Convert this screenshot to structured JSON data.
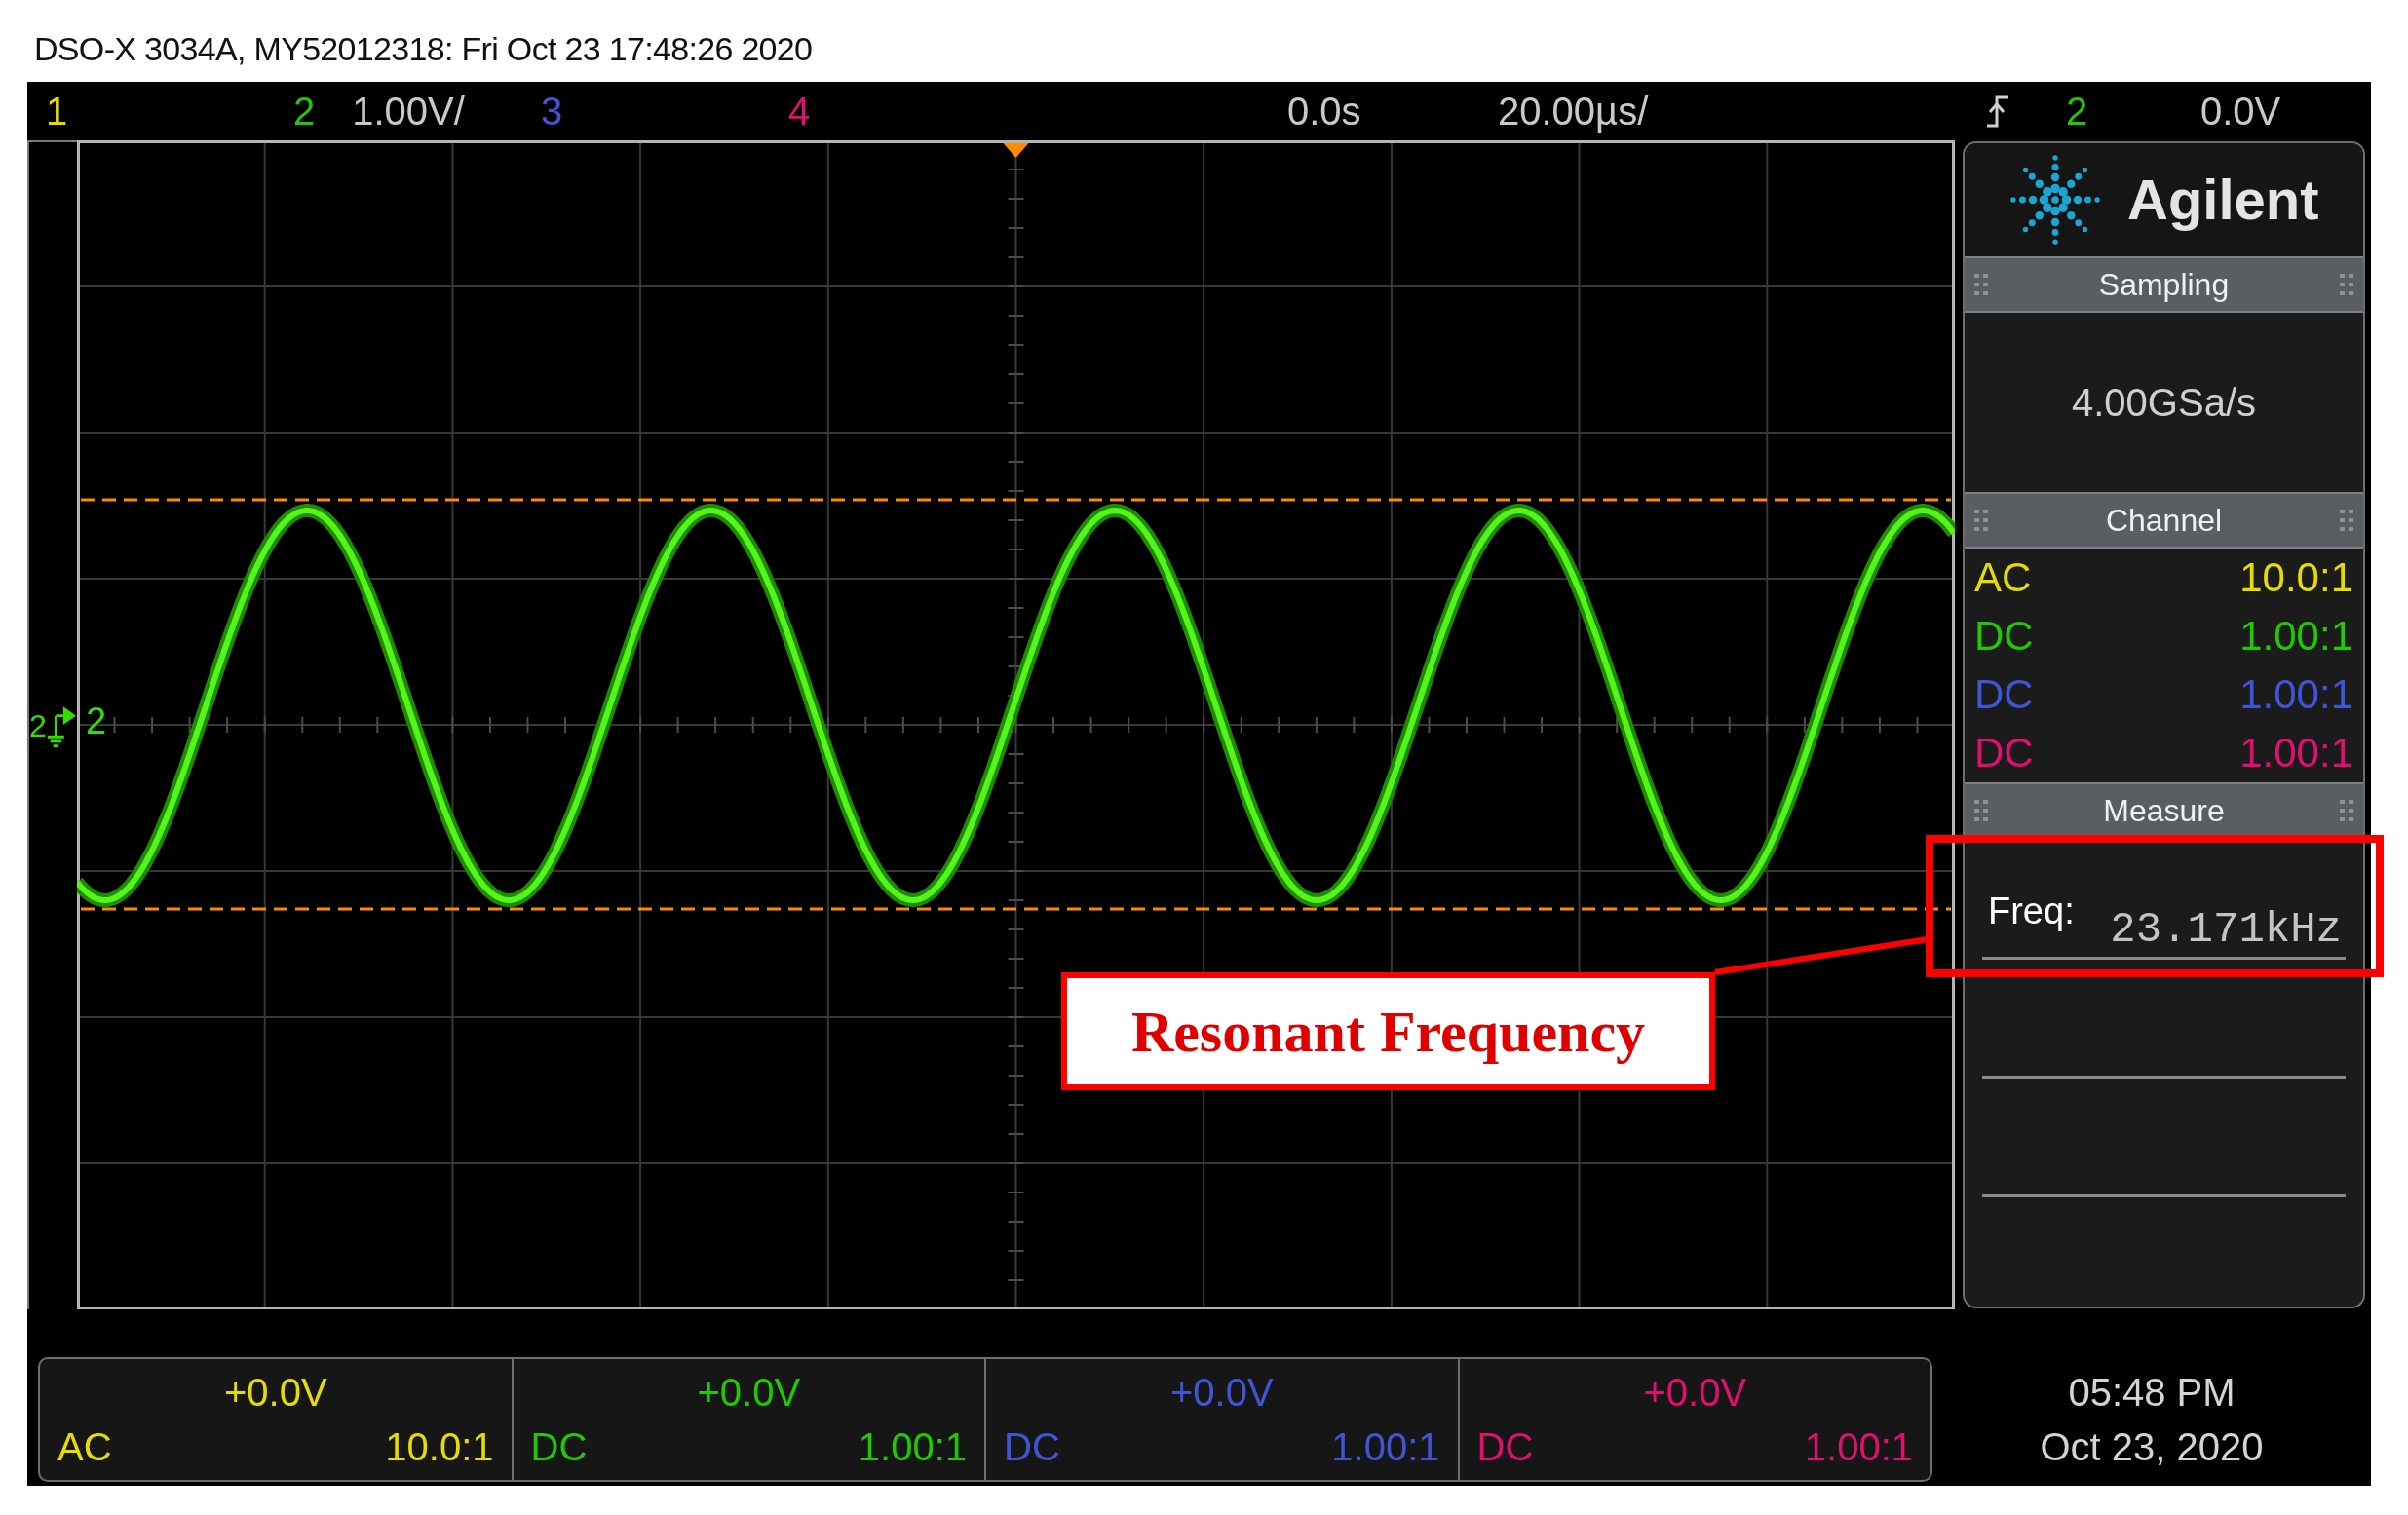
{
  "title": "DSO-X 3034A, MY52012318: Fri Oct 23 17:48:26 2020",
  "status_bar": {
    "channels": [
      {
        "label": "1",
        "color": "#e6dc00"
      },
      {
        "label": "2",
        "scale": "1.00V/",
        "color": "#22c800"
      },
      {
        "label": "3",
        "color": "#3f55d6"
      },
      {
        "label": "4",
        "color": "#e01070"
      }
    ],
    "time_offset": "0.0s",
    "time_scale": "20.00µs/",
    "trigger": {
      "source": "2",
      "threshold": "0.0V"
    }
  },
  "graticule": {
    "ground_label": "2",
    "trace_label": "2"
  },
  "side_panel": {
    "brand": "Agilent",
    "sections": [
      {
        "kind": "sampling",
        "title": "Sampling",
        "value": "4.00GSa/s"
      },
      {
        "kind": "channel",
        "title": "Channel",
        "rows": [
          {
            "coupling": "AC",
            "probe": "10.0:1",
            "color": "#e6dc00"
          },
          {
            "coupling": "DC",
            "probe": "1.00:1",
            "color": "#22c800"
          },
          {
            "coupling": "DC",
            "probe": "1.00:1",
            "color": "#3f55d6"
          },
          {
            "coupling": "DC",
            "probe": "1.00:1",
            "color": "#e01070"
          }
        ]
      },
      {
        "kind": "measure",
        "title": "Measure",
        "rows": [
          {
            "label": "Freq:",
            "value": "23.171kHz"
          }
        ]
      }
    ]
  },
  "bottom_bar": {
    "channels": [
      {
        "offset": "+0.0V",
        "coupling": "AC",
        "probe": "10.0:1",
        "color": "#e6dc00"
      },
      {
        "offset": "+0.0V",
        "coupling": "DC",
        "probe": "1.00:1",
        "color": "#22c800"
      },
      {
        "offset": "+0.0V",
        "coupling": "DC",
        "probe": "1.00:1",
        "color": "#3f55d6"
      },
      {
        "offset": "+0.0V",
        "coupling": "DC",
        "probe": "1.00:1",
        "color": "#e01070"
      }
    ],
    "time": "05:48 PM",
    "date": "Oct 23, 2020"
  },
  "annotation": {
    "text": "Resonant Frequency"
  }
}
